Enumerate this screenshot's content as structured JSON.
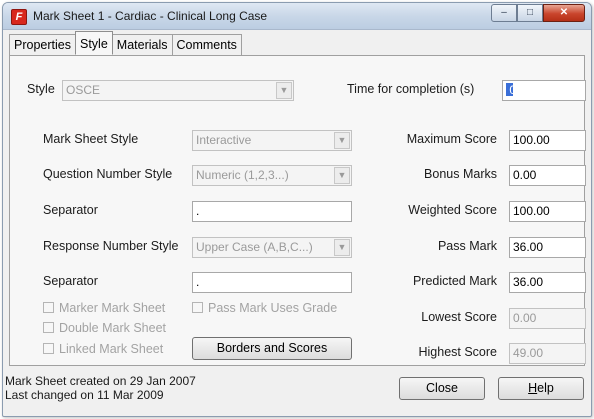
{
  "window": {
    "title": "Mark Sheet 1 - Cardiac - Clinical Long Case",
    "app_icon": "red-f-app-icon",
    "controls": {
      "minimize": "minimize-icon",
      "maximize": "maximize-icon",
      "close": "close-icon"
    }
  },
  "tabs": [
    {
      "label": "Properties",
      "active": false
    },
    {
      "label": "Style",
      "active": true
    },
    {
      "label": "Materials",
      "active": false
    },
    {
      "label": "Comments",
      "active": false
    }
  ],
  "style": {
    "style_label": "Style",
    "style_value": "OSCE",
    "time_label": "Time for completion (s)",
    "time_value": "0",
    "mark_sheet_style_label": "Mark Sheet Style",
    "mark_sheet_style_value": "Interactive",
    "question_number_style_label": "Question Number Style",
    "question_number_style_value": "Numeric (1,2,3...)",
    "separator1_label": "Separator",
    "separator1_value": ".",
    "response_number_style_label": "Response Number Style",
    "response_number_style_value": "Upper Case (A,B,C...)",
    "separator2_label": "Separator",
    "separator2_value": ".",
    "checkboxes": {
      "marker_mark_sheet": "Marker Mark Sheet",
      "pass_mark_uses_grade": "Pass Mark Uses Grade",
      "double_mark_sheet": "Double Mark Sheet",
      "linked_mark_sheet": "Linked Mark Sheet"
    },
    "borders_button": "Borders and Scores"
  },
  "scores": {
    "maximum_score_label": "Maximum Score",
    "maximum_score_value": "100.00",
    "bonus_marks_label": "Bonus Marks",
    "bonus_marks_value": "0.00",
    "weighted_score_label": "Weighted Score",
    "weighted_score_value": "100.00",
    "pass_mark_label": "Pass Mark",
    "pass_mark_value": "36.00",
    "predicted_mark_label": "Predicted Mark",
    "predicted_mark_value": "36.00",
    "lowest_score_label": "Lowest Score",
    "lowest_score_value": "0.00",
    "highest_score_label": "Highest Score",
    "highest_score_value": "49.00"
  },
  "footer": {
    "created": "Mark Sheet created on 29 Jan 2007",
    "changed": "Last changed on 11 Mar 2009",
    "close_button": "Close",
    "help_button_rest": "elp",
    "help_button_underlined": "H"
  },
  "colors": {
    "accent_caret": "#3a6fd8",
    "close_button": "#c9452c",
    "app_icon": "#d8271d"
  }
}
